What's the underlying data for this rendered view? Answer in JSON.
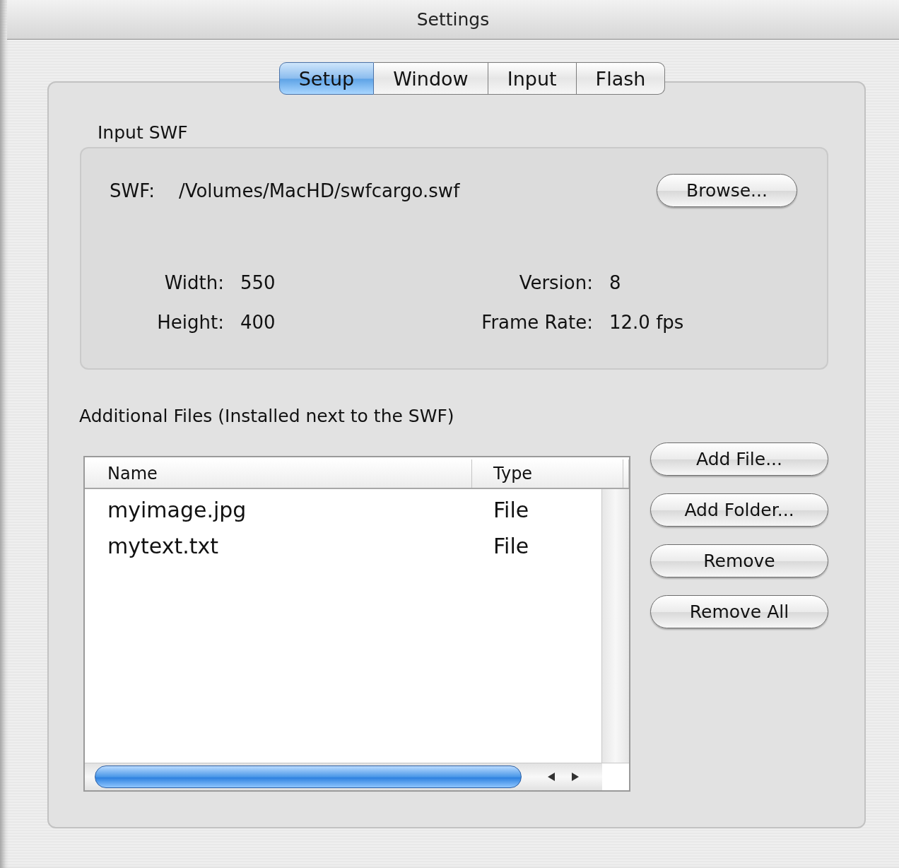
{
  "window": {
    "title": "Settings"
  },
  "tabs": [
    {
      "label": "Setup",
      "selected": true
    },
    {
      "label": "Window",
      "selected": false
    },
    {
      "label": "Input",
      "selected": false
    },
    {
      "label": "Flash",
      "selected": false
    }
  ],
  "input_swf": {
    "title": "Input SWF",
    "swf_label": "SWF:",
    "swf_path": "/Volumes/MacHD/swfcargo.swf",
    "browse_button": "Browse...",
    "info": [
      {
        "label": "Width:",
        "value": "550"
      },
      {
        "label": "Version:",
        "value": "8"
      },
      {
        "label": "Height:",
        "value": "400"
      },
      {
        "label": "Frame Rate:",
        "value": "12.0 fps"
      }
    ]
  },
  "additional_files": {
    "title": "Additional Files (Installed next to the SWF)",
    "table": {
      "columns": [
        "Name",
        "Type"
      ],
      "rows": [
        {
          "name": "myimage.jpg",
          "type": "File"
        },
        {
          "name": "mytext.txt",
          "type": "File"
        }
      ]
    },
    "buttons": [
      "Add File...",
      "Add Folder...",
      "Remove",
      "Remove All"
    ]
  }
}
